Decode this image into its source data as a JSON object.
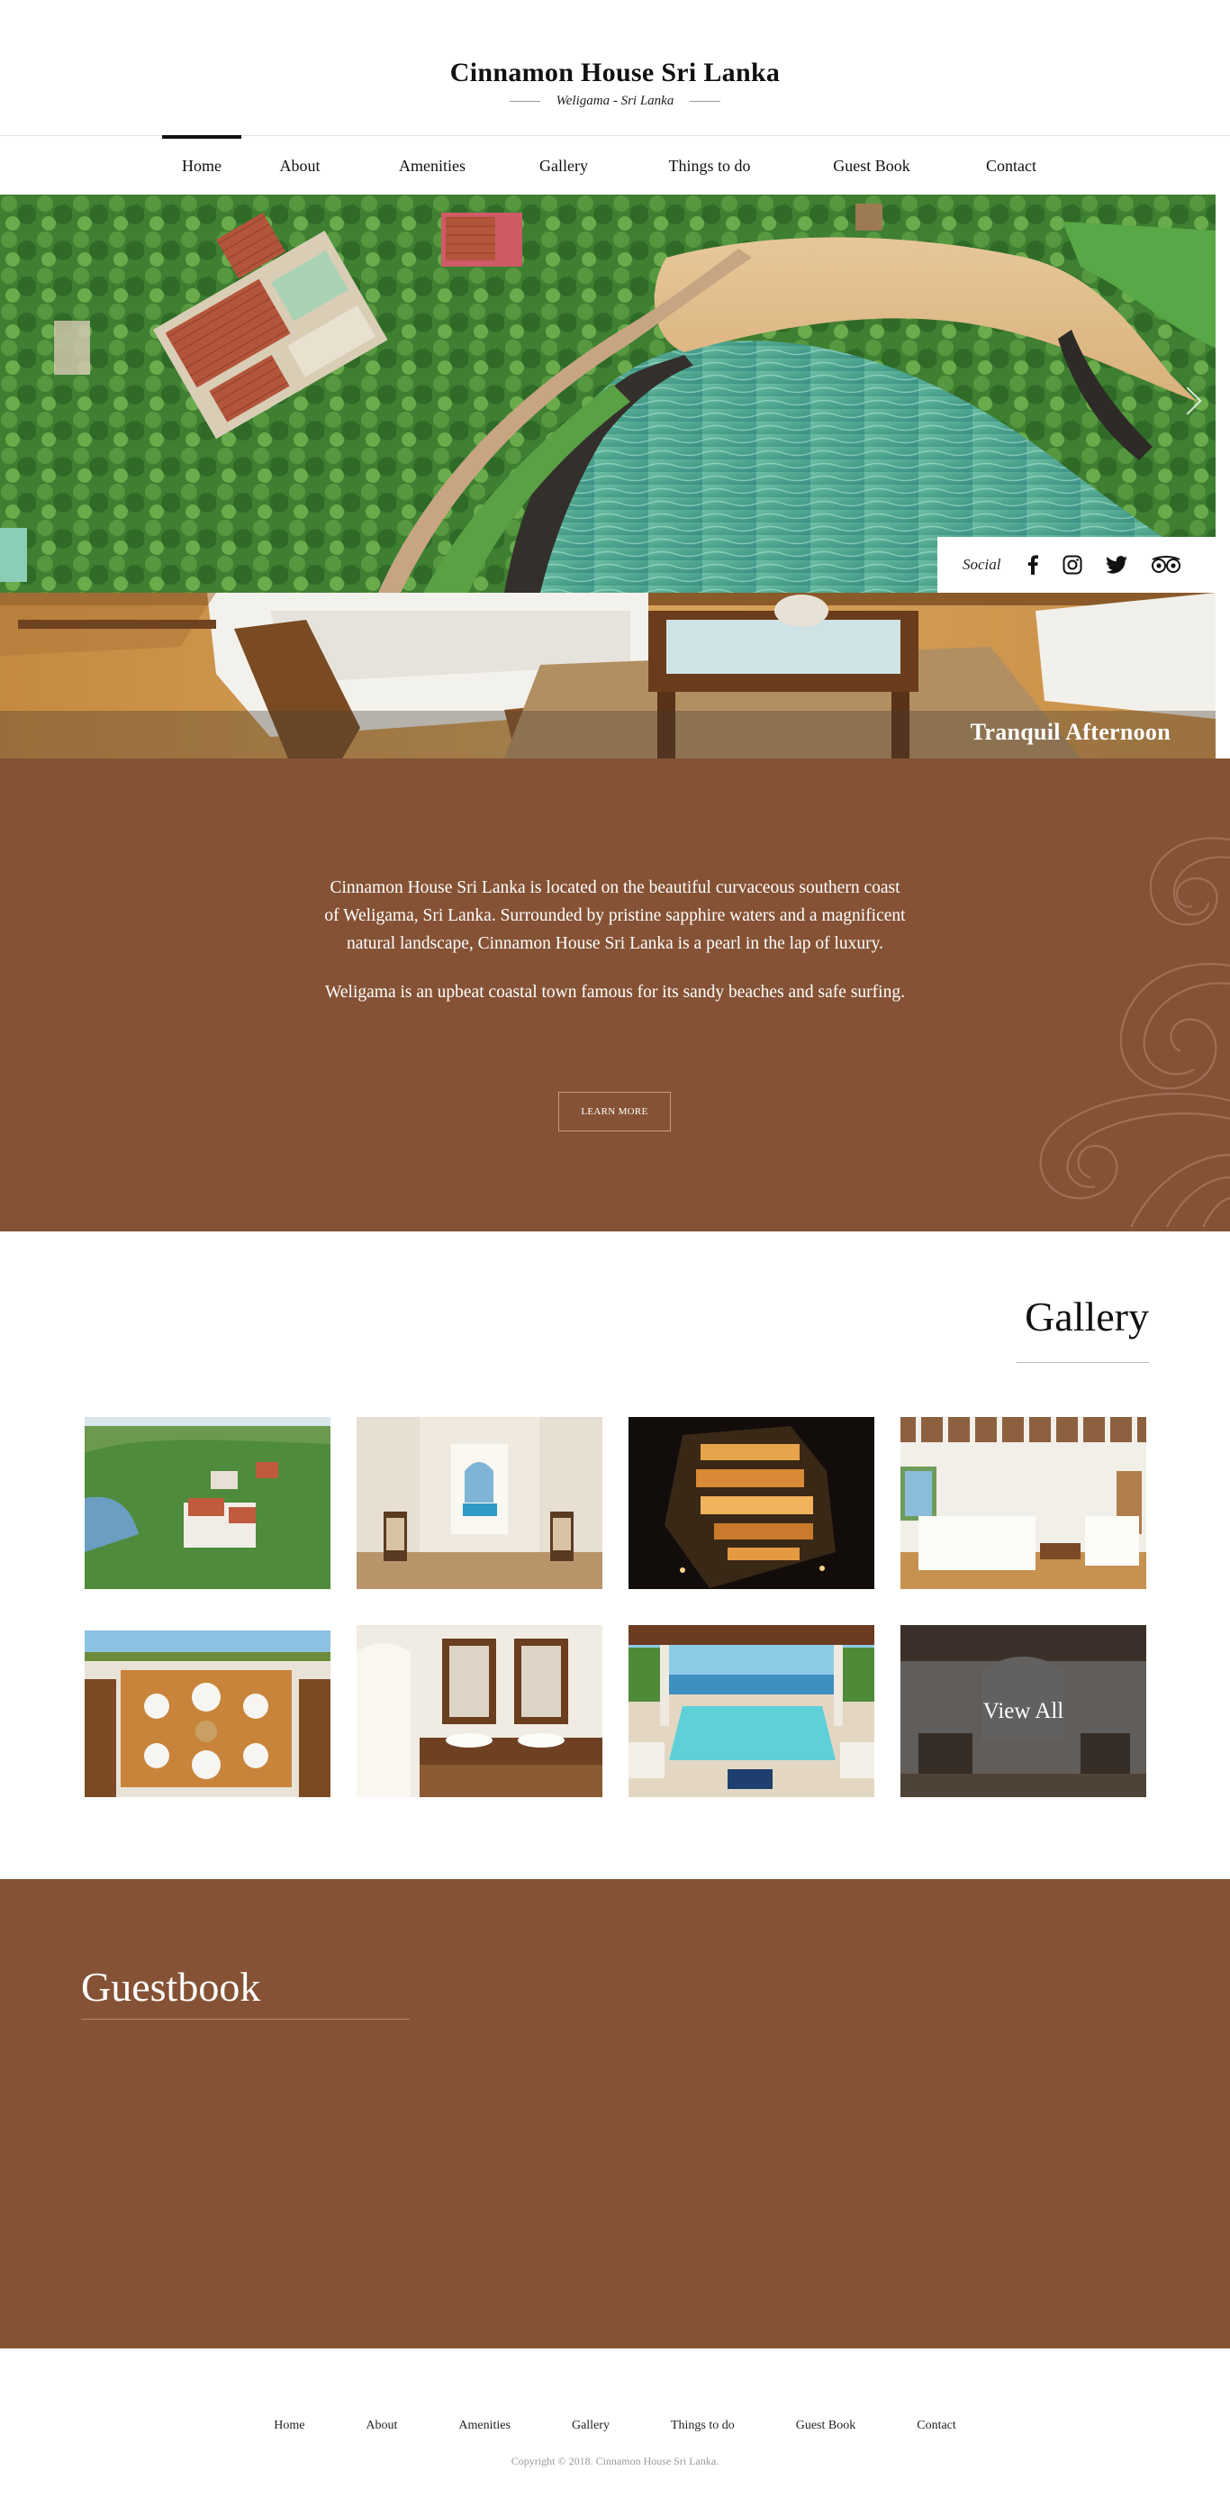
{
  "header": {
    "title": "Cinnamon House Sri Lanka",
    "subtitle": "Weligama - Sri Lanka"
  },
  "nav": {
    "items": [
      {
        "label": "Home",
        "active": true
      },
      {
        "label": "About"
      },
      {
        "label": "Amenities"
      },
      {
        "label": "Gallery"
      },
      {
        "label": "Things to do"
      },
      {
        "label": "Guest Book"
      },
      {
        "label": "Contact"
      }
    ]
  },
  "hero": {
    "caption": "Tranquil Afternoon",
    "social_label": "Social",
    "social_icons": [
      "facebook-icon",
      "instagram-icon",
      "twitter-icon",
      "tripadvisor-icon"
    ]
  },
  "about": {
    "paragraph1": "Cinnamon House Sri Lanka is located on the beautiful curvaceous southern coast of Weligama, Sri Lanka. Surrounded by pristine sapphire waters and a magnificent natural landscape, Cinnamon House Sri Lanka is a pearl in the lap of luxury.",
    "paragraph2": "Weligama is an upbeat coastal town famous for its sandy beaches and safe surfing.",
    "button_label": "LEARN MORE"
  },
  "gallery": {
    "title": "Gallery",
    "view_all_label": "View All"
  },
  "guestbook": {
    "title": "Guestbook"
  },
  "footer": {
    "links": [
      "Home",
      "About",
      "Amenities",
      "Gallery",
      "Things to do",
      "Guest Book",
      "Contact"
    ],
    "copyright": "Copyright © 2018. Cinnamon House Sri Lanka."
  },
  "colors": {
    "brand_brown": "#855235",
    "text_dark": "#111111",
    "footer_gray": "#999999"
  }
}
